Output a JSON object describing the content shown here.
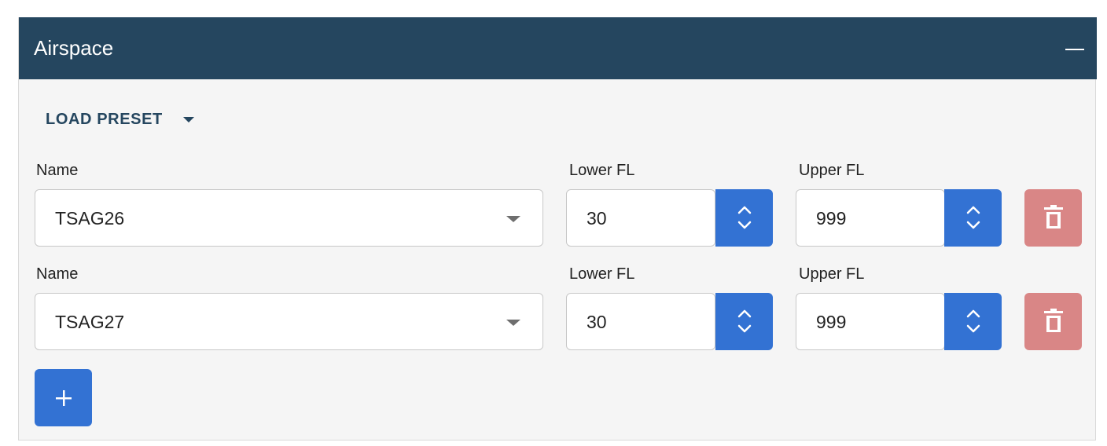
{
  "panel": {
    "title": "Airspace",
    "collapse_icon": "minus-icon"
  },
  "preset": {
    "label": "LOAD PRESET",
    "icon": "caret-down-icon"
  },
  "rows": [
    {
      "name_label": "Name",
      "name_value": "TSAG26",
      "lower_label": "Lower FL",
      "lower_value": "30",
      "upper_label": "Upper FL",
      "upper_value": "999"
    },
    {
      "name_label": "Name",
      "name_value": "TSAG27",
      "lower_label": "Lower FL",
      "lower_value": "30",
      "upper_label": "Upper FL",
      "upper_value": "999"
    }
  ],
  "icons": {
    "spinner": "chevron-up-down-icon",
    "delete": "trash-icon",
    "add": "plus-icon",
    "dropdown": "caret-down-icon"
  },
  "colors": {
    "header_bg": "#25465f",
    "primary": "#3372d3",
    "danger": "#d98686"
  }
}
